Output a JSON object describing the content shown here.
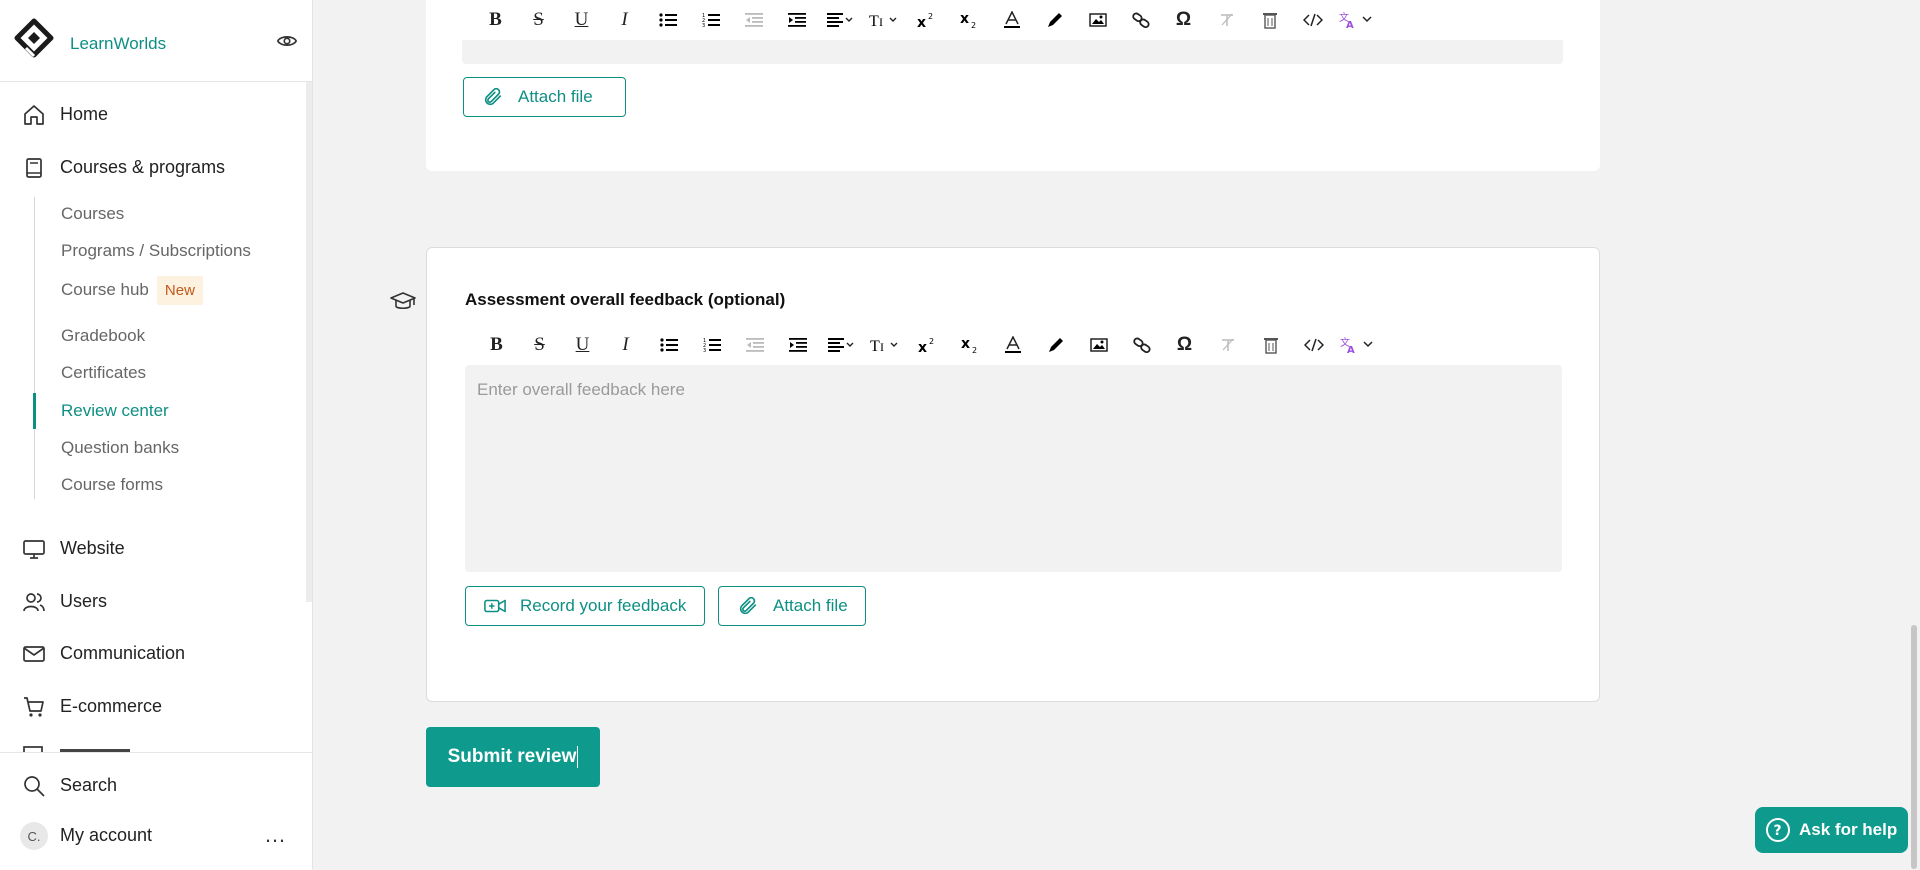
{
  "brand": {
    "name": "LearnWorlds"
  },
  "nav": {
    "home": "Home",
    "courses_programs": "Courses & programs",
    "website": "Website",
    "users": "Users",
    "communication": "Communication",
    "ecommerce": "E-commerce",
    "search": "Search",
    "my_account": "My account",
    "account_initial": "C.",
    "more": "…"
  },
  "sub_nav": {
    "items": [
      {
        "label": "Courses"
      },
      {
        "label": "Programs / Subscriptions"
      },
      {
        "label": "Course hub",
        "badge": "New"
      },
      {
        "label": "Gradebook"
      },
      {
        "label": "Certificates"
      },
      {
        "label": "Review center",
        "active": true
      },
      {
        "label": "Question banks"
      },
      {
        "label": "Course forms"
      }
    ]
  },
  "editor_toolbar": {
    "buttons": [
      "bold",
      "strikethrough",
      "underline",
      "italic",
      "bullet-list",
      "numbered-list",
      "outdent",
      "indent",
      "align",
      "text-size",
      "superscript",
      "subscript",
      "font-color",
      "highlight",
      "image",
      "link",
      "special-char",
      "clear-format",
      "delete",
      "code",
      "translate"
    ]
  },
  "card_top": {
    "attach_file": "Attach file"
  },
  "feedback": {
    "title": "Assessment overall feedback (optional)",
    "placeholder": "Enter overall feedback here",
    "record_button": "Record your feedback",
    "attach_file": "Attach file"
  },
  "actions": {
    "submit": "Submit review"
  },
  "help": {
    "label": "Ask for help"
  },
  "colors": {
    "accent": "#0e8f83",
    "button_fill": "#0e9a8c",
    "badge_bg": "#fdf1df",
    "badge_text": "#c05a1a",
    "ai_icon": "#9b4de0"
  }
}
